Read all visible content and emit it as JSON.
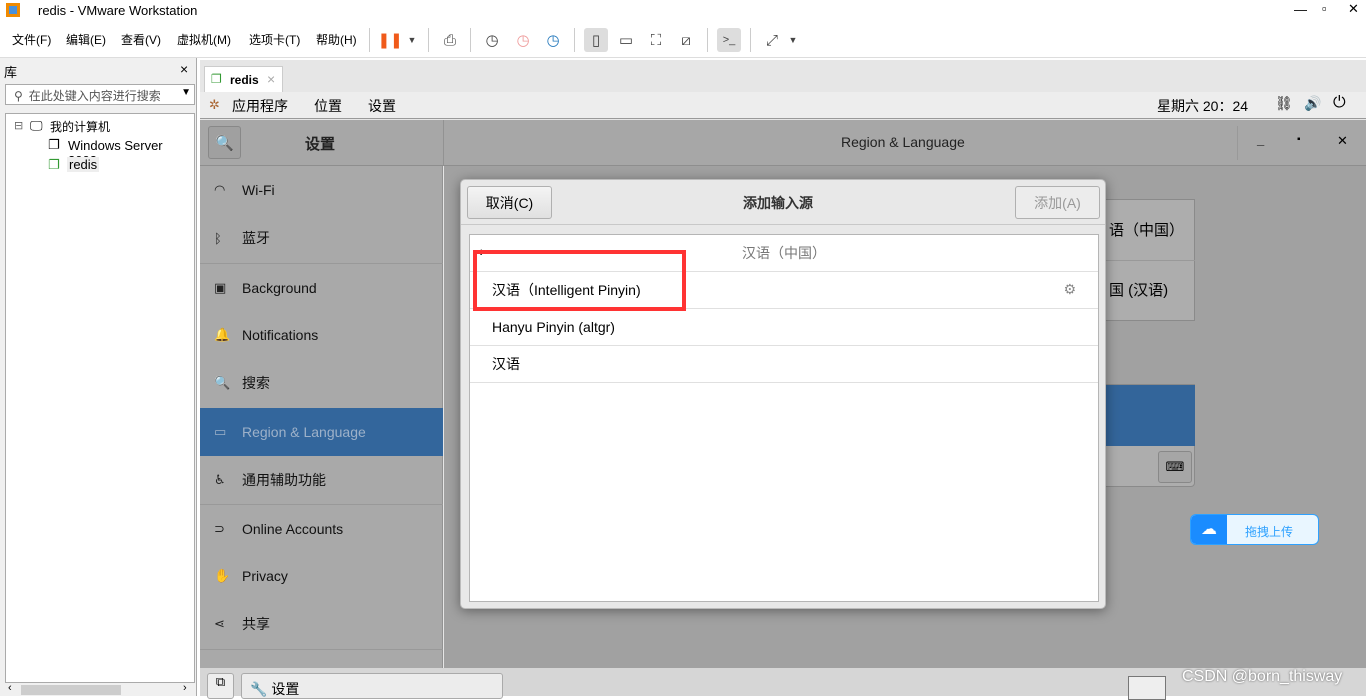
{
  "window": {
    "title": "redis - VMware Workstation"
  },
  "menu": [
    "文件(F)",
    "编辑(E)",
    "查看(V)",
    "虚拟机(M)",
    "选项卡(T)",
    "帮助(H)"
  ],
  "library": {
    "title": "库",
    "close": "×",
    "search_placeholder": "在此处键入内容进行搜索",
    "root": "我的计算机",
    "items": [
      "Windows Server 2003",
      "redis"
    ]
  },
  "tab": {
    "label": "redis",
    "close": "×"
  },
  "gnome": {
    "apps": "应用程序",
    "places": "位置",
    "settings": "设置",
    "clock": "星期六 20：24"
  },
  "settings": {
    "title": "设置",
    "panel_title": "Region & Language",
    "sidebar": [
      "Wi-Fi",
      "蓝牙",
      "Background",
      "Notifications",
      "搜索",
      "Region & Language",
      "通用辅助功能",
      "Online Accounts",
      "Privacy",
      "共享"
    ],
    "selected": "Region & Language",
    "lang_rows": [
      "语（中国）",
      "国 (汉语)"
    ]
  },
  "dialog": {
    "cancel": "取消(C)",
    "title": "添加输入源",
    "add": "添加(A)",
    "header": "汉语（中国）",
    "rows": [
      "汉语（Intelligent Pinyin)",
      "Hanyu Pinyin (altgr)",
      "汉语"
    ]
  },
  "bottom": {
    "task": "设置"
  },
  "upload": {
    "label": "拖拽上传"
  },
  "watermark": "CSDN @born_thisway",
  "colors": {
    "selected": "#33669c",
    "highlight": "#ff3333",
    "upload": "#2ea1ff"
  }
}
